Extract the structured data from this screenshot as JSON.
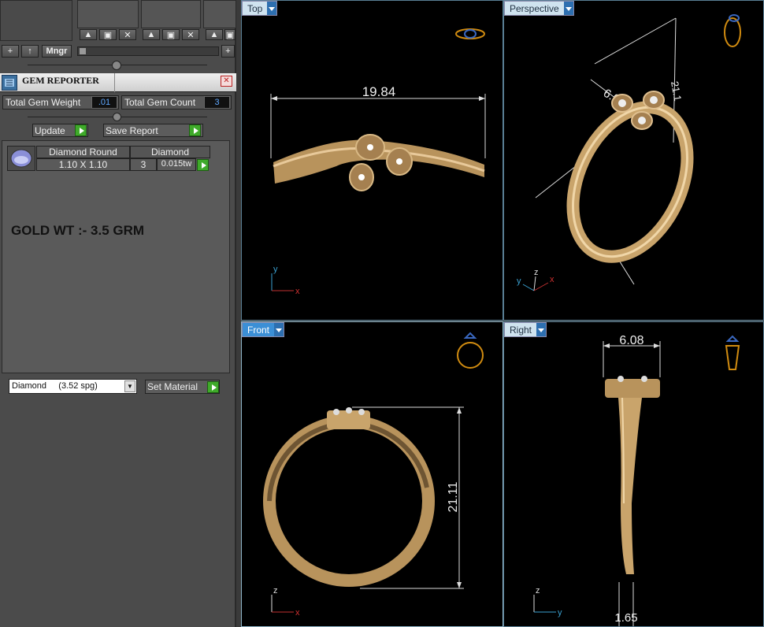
{
  "toolbar": {
    "new_label": "+",
    "up_label": "↑",
    "manager_label": "Mngr",
    "add_label": "+"
  },
  "panel": {
    "title": "GEM REPORTER",
    "close_label": "✕"
  },
  "summary": {
    "total_weight_label": "Total Gem Weight",
    "total_weight_value": ".01",
    "total_count_label": "Total Gem Count",
    "total_count_value": "3"
  },
  "actions": {
    "update_label": "Update",
    "save_report_label": "Save Report"
  },
  "gem_table": {
    "headers": [
      "Diamond Round",
      "Diamond"
    ],
    "rows": [
      {
        "size": "1.10 X 1.10",
        "count": "3",
        "weight": "0.015tw"
      }
    ]
  },
  "note": "GOLD WT :- 3.5 GRM",
  "material": {
    "selected": "Diamond     (3.52 spg)",
    "set_label": "Set Material"
  },
  "viewports": {
    "top": {
      "label": "Top",
      "dimension": "19.84",
      "axes": {
        "v": "y",
        "h": "x"
      }
    },
    "perspective": {
      "label": "Perspective",
      "dimension_a": "6.0",
      "dimension_b": "21.1",
      "axes": {
        "a": "y",
        "b": "z",
        "c": "x"
      }
    },
    "front": {
      "label": "Front",
      "dimension": "21.11",
      "axes": {
        "v": "z",
        "h": "x"
      }
    },
    "right": {
      "label": "Right",
      "dimension_top": "6.08",
      "dimension_bottom": "1.65",
      "axes": {
        "v": "z",
        "h": "y"
      }
    }
  },
  "colors": {
    "gold": "#c9a46b",
    "accent": "#3b8fd6",
    "viewport_bg": "#000000"
  }
}
